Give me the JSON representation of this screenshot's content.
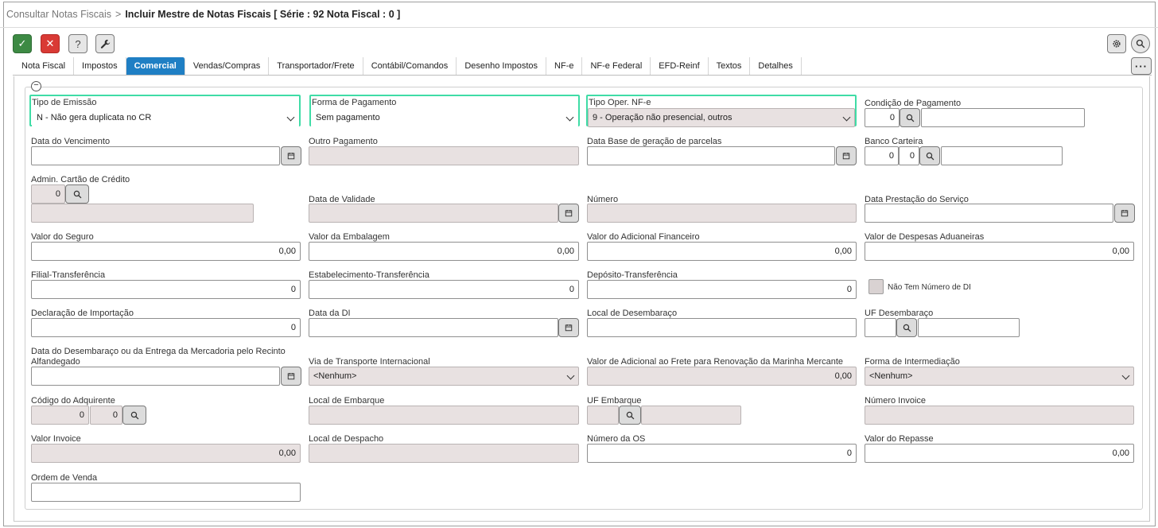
{
  "breadcrumb": {
    "root": "Consultar Notas Fiscais",
    "separator": ">",
    "current": "Incluir Mestre de Notas Fiscais",
    "detail": "[ Série : 92 Nota Fiscal : 0 ]"
  },
  "toolbar": {
    "confirm": "✓",
    "cancel": "✕",
    "help": "?",
    "more": "···"
  },
  "tabs": [
    "Nota Fiscal",
    "Impostos",
    "Comercial",
    "Vendas/Compras",
    "Transportador/Frete",
    "Contábil/Comandos",
    "Desenho Impostos",
    "NF-e",
    "NF-e Federal",
    "EFD-Reinf",
    "Textos",
    "Detalhes"
  ],
  "active_tab": "Comercial",
  "form": {
    "tipo_emissao": {
      "label": "Tipo de Emissão",
      "value": "N - Não gera duplicata no CR"
    },
    "forma_pagamento": {
      "label": "Forma de Pagamento",
      "value": "Sem pagamento"
    },
    "tipo_oper_nfe": {
      "label": "Tipo Oper. NF-e",
      "value": "9 - Operação não presencial, outros"
    },
    "condicao_pagamento": {
      "label": "Condição de Pagamento",
      "value": "0"
    },
    "data_vencimento": {
      "label": "Data do Vencimento"
    },
    "outro_pagamento": {
      "label": "Outro Pagamento"
    },
    "data_base_parcelas": {
      "label": "Data Base de geração de parcelas"
    },
    "banco_carteira": {
      "label": "Banco Carteira",
      "value1": "0",
      "value2": "0"
    },
    "admin_cartao": {
      "label": "Admin. Cartão de Crédito",
      "value": "0"
    },
    "data_validade": {
      "label": "Data de Validade"
    },
    "numero": {
      "label": "Número"
    },
    "data_prestacao": {
      "label": "Data Prestação do Serviço"
    },
    "valor_seguro": {
      "label": "Valor do Seguro",
      "value": "0,00"
    },
    "valor_embalagem": {
      "label": "Valor da Embalagem",
      "value": "0,00"
    },
    "valor_adicional_financeiro": {
      "label": "Valor do Adicional Financeiro",
      "value": "0,00"
    },
    "valor_despesas_aduaneiras": {
      "label": "Valor de Despesas Aduaneiras",
      "value": "0,00"
    },
    "filial_transferencia": {
      "label": "Filial-Transferência",
      "value": "0"
    },
    "estabelecimento_transferencia": {
      "label": "Estabelecimento-Transferência",
      "value": "0"
    },
    "deposito_transferencia": {
      "label": "Depósito-Transferência",
      "value": "0"
    },
    "nao_tem_numero_di": {
      "label": "Não Tem Número de DI",
      "checked": false
    },
    "declaracao_importacao": {
      "label": "Declaração de Importação",
      "value": "0"
    },
    "data_di": {
      "label": "Data da DI"
    },
    "local_desembaraco": {
      "label": "Local de Desembaraço"
    },
    "uf_desembaraco": {
      "label": "UF Desembaraço"
    },
    "data_desembaraco": {
      "label_line1": "Data do Desembaraço ou da Entrega da Mercadoria pelo Recinto",
      "label_line2": "Alfandegado"
    },
    "via_transporte": {
      "label": "Via de Transporte Internacional",
      "value": "<Nenhum>"
    },
    "valor_adicional_frete": {
      "label": "Valor de Adicional ao Frete para Renovação da Marinha Mercante",
      "value": "0,00"
    },
    "forma_intermediacao": {
      "label": "Forma de Intermediação",
      "value": "<Nenhum>"
    },
    "codigo_adquirente": {
      "label": "Código do Adquirente",
      "value1": "0",
      "value2": "0"
    },
    "local_embarque": {
      "label": "Local de Embarque"
    },
    "uf_embarque": {
      "label": "UF Embarque"
    },
    "numero_invoice": {
      "label": "Número Invoice"
    },
    "valor_invoice": {
      "label": "Valor Invoice",
      "value": "0,00"
    },
    "local_despacho": {
      "label": "Local de Despacho"
    },
    "numero_os": {
      "label": "Número da OS",
      "value": "0"
    },
    "valor_repasse": {
      "label": "Valor do Repasse",
      "value": "0,00"
    },
    "ordem_venda": {
      "label": "Ordem de Venda"
    }
  },
  "colors": {
    "accent": "#1f7fc4",
    "confirm": "#3d8a44",
    "cancel": "#d93a35",
    "highlight": "#3fdca6",
    "readonly": "#e8e1e1"
  },
  "icons": [
    "check-icon",
    "close-icon",
    "help-icon",
    "wrench-icon",
    "gear-icon",
    "search-icon",
    "more-icon",
    "collapse-icon",
    "calendar-icon",
    "chevron-down-icon"
  ]
}
